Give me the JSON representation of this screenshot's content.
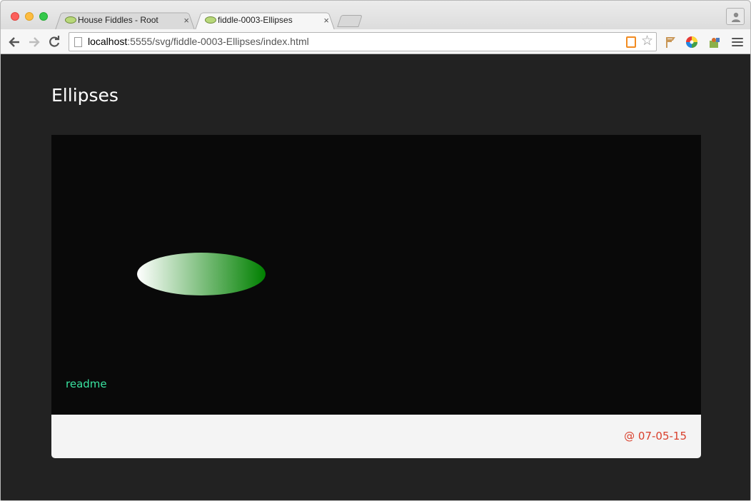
{
  "browser": {
    "tabs": [
      {
        "title": "House Fiddles - Root",
        "close": "×"
      },
      {
        "title": "fiddle-0003-Ellipses",
        "close": "×"
      }
    ],
    "url": {
      "host": "localhost",
      "rest": ":5555/svg/fiddle-0003-Ellipses/index.html"
    },
    "star": "☆"
  },
  "page": {
    "title": "Ellipses",
    "readme": "readme",
    "date": "@ 07-05-15"
  },
  "colors": {
    "page_bg": "#222222",
    "stage_bg": "#090909",
    "ellipse_start": "#ffffff",
    "ellipse_end": "#008000",
    "readme": "#39e3a0",
    "date": "#d9402c",
    "footer_bg": "#f4f4f4"
  }
}
